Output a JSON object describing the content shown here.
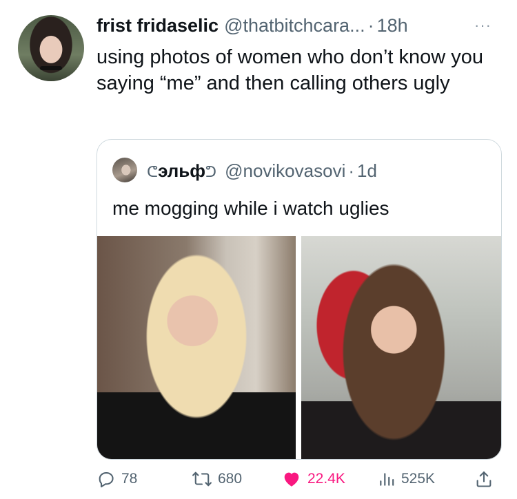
{
  "tweet": {
    "display_name": "frist fridaselic",
    "handle": "@thatbitchcara...",
    "separator": "·",
    "time": "18h",
    "more": "···",
    "text": "using photos of women who don’t know you saying “me” and then calling others ugly"
  },
  "quote": {
    "name_prefix": "ᕦ",
    "display_name": "эльф",
    "name_suffix": "ᕤ",
    "handle": "@novikovasovi",
    "separator": "·",
    "time": "1d",
    "text": "me mogging while i watch uglies"
  },
  "actions": {
    "reply_count": "78",
    "repost_count": "680",
    "like_count": "22.4K",
    "views_count": "525K"
  },
  "colors": {
    "like_active": "#f91880",
    "secondary_text": "#536471",
    "border": "#cfd9de"
  },
  "icons": [
    "more-icon",
    "reply-icon",
    "repost-icon",
    "like-icon",
    "views-icon",
    "share-icon"
  ]
}
